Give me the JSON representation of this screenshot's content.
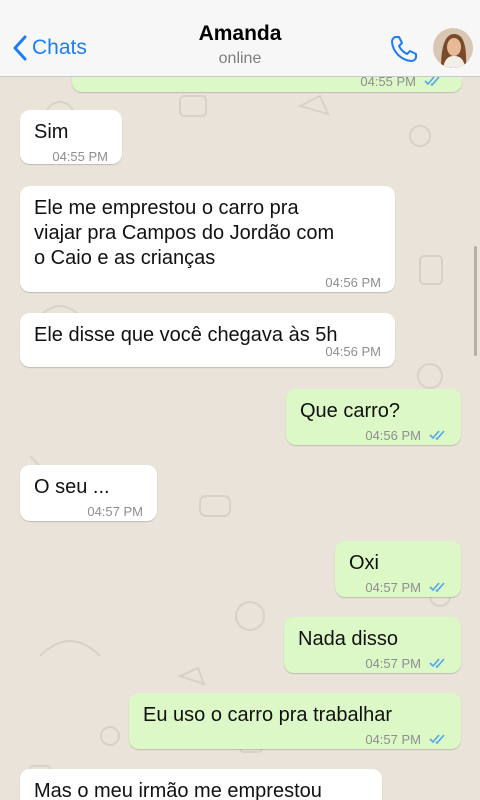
{
  "header": {
    "back_label": "Chats",
    "contact_name": "Amanda",
    "status": "online"
  },
  "colors": {
    "accent": "#1e7cf6",
    "incoming_bubble": "#ffffff",
    "outgoing_bubble": "#dcf8c6",
    "read_ticks": "#4fa6e8"
  },
  "messages": [
    {
      "direction": "out",
      "text": "",
      "time": "04:55 PM",
      "read": true
    },
    {
      "direction": "in",
      "text": "Sim",
      "time": "04:55 PM"
    },
    {
      "direction": "in",
      "text": "Ele me emprestou o carro pra\nviajar pra Campos do Jordão com\no Caio e as crianças",
      "time": "04:56 PM"
    },
    {
      "direction": "in",
      "text": "Ele disse que você chegava às 5h",
      "time": "04:56 PM"
    },
    {
      "direction": "out",
      "text": "Que carro?",
      "time": "04:56 PM",
      "read": true
    },
    {
      "direction": "in",
      "text": "O seu ...",
      "time": "04:57 PM"
    },
    {
      "direction": "out",
      "text": "Oxi",
      "time": "04:57 PM",
      "read": true
    },
    {
      "direction": "out",
      "text": "Nada disso",
      "time": "04:57 PM",
      "read": true
    },
    {
      "direction": "out",
      "text": "Eu uso o carro pra trabalhar",
      "time": "04:57 PM",
      "read": true
    },
    {
      "direction": "in",
      "text": "Mas o meu irmão me emprestou",
      "time": ""
    }
  ]
}
